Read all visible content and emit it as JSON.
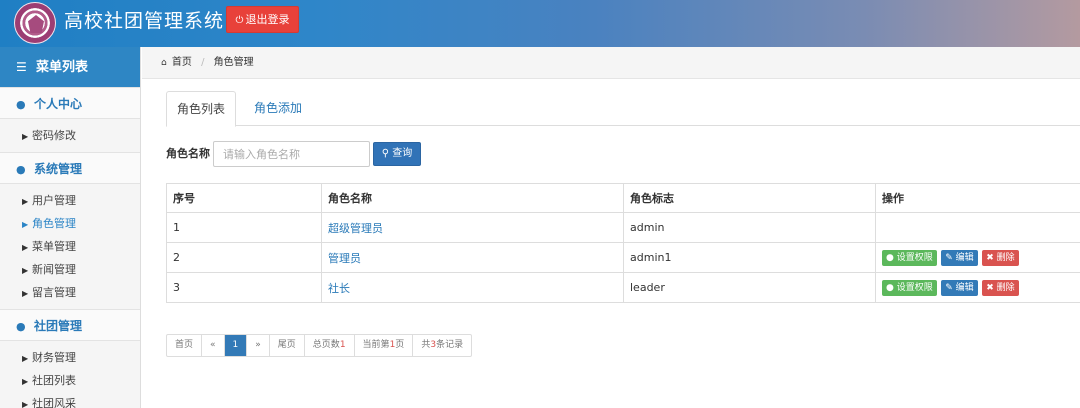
{
  "header": {
    "title": "高校社团管理系统",
    "logout_label": "退出登录"
  },
  "sidebar": {
    "menu_title": "菜单列表",
    "groups": [
      {
        "label": "个人中心",
        "items": [
          "密码修改"
        ]
      },
      {
        "label": "系统管理",
        "items": [
          "用户管理",
          "角色管理",
          "菜单管理",
          "新闻管理",
          "留言管理"
        ]
      },
      {
        "label": "社团管理",
        "items": [
          "财务管理",
          "社团列表",
          "社团风采"
        ]
      }
    ],
    "active_item": "角色管理"
  },
  "breadcrumb": {
    "home": "首页",
    "current": "角色管理"
  },
  "tabs": [
    "角色列表",
    "角色添加"
  ],
  "search": {
    "label": "角色名称",
    "placeholder": "请输入角色名称",
    "button": "查询"
  },
  "table": {
    "headers": [
      "序号",
      "角色名称",
      "角色标志",
      "操作"
    ],
    "rows": [
      {
        "no": "1",
        "name": "超级管理员",
        "flag": "admin"
      },
      {
        "no": "2",
        "name": "管理员",
        "flag": "admin1"
      },
      {
        "no": "3",
        "name": "社长",
        "flag": "leader"
      }
    ],
    "actions": {
      "perm": "设置权限",
      "edit": "编辑",
      "delete": "删除"
    }
  },
  "pager": {
    "first": "首页",
    "prev": "«",
    "page": "1",
    "next": "»",
    "last": "尾页",
    "total_pages_prefix": "总页数",
    "total_pages": "1",
    "current_prefix": "当前第",
    "current": "1",
    "current_suffix": "页",
    "records_prefix": "共",
    "records": "3",
    "records_suffix": "条记录"
  },
  "colors": {
    "accent": "#2e86c4",
    "danger": "#e8413a",
    "success": "#5cb85c",
    "primary": "#337ab7"
  }
}
